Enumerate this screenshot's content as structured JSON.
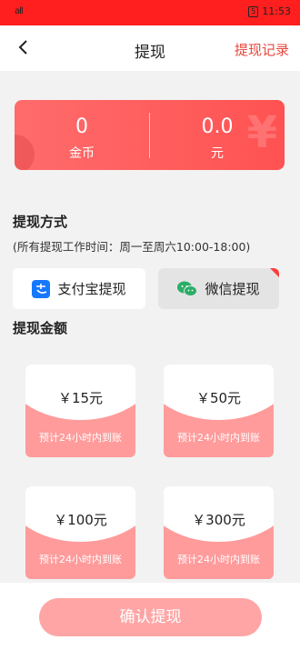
{
  "status_bar": {
    "signal": "all",
    "battery": "5",
    "time": "11:53"
  },
  "nav": {
    "title": "提现",
    "records_label": "提现记录"
  },
  "balance": {
    "coins_value": "0",
    "coins_label": "金币",
    "yuan_value": "0.0",
    "yuan_label": "元"
  },
  "method_section": {
    "title": "提现方式",
    "note": "(所有提现工作时间：周一至周六10:00-18:00)",
    "alipay_label": "支付宝提现",
    "wechat_label": "微信提现"
  },
  "amount_section": {
    "title": "提现金额",
    "options": [
      {
        "price": "￥15元",
        "eta": "预计24小时内到账"
      },
      {
        "price": "￥50元",
        "eta": "预计24小时内到账"
      },
      {
        "price": "￥100元",
        "eta": "预计24小时内到账"
      },
      {
        "price": "￥300元",
        "eta": "预计24小时内到账"
      }
    ]
  },
  "confirm_label": "确认提现",
  "colors": {
    "accent": "#e8453c",
    "status_bar": "#ff1f1f",
    "card": "#ff9b9b",
    "button": "#ffa5a5"
  }
}
